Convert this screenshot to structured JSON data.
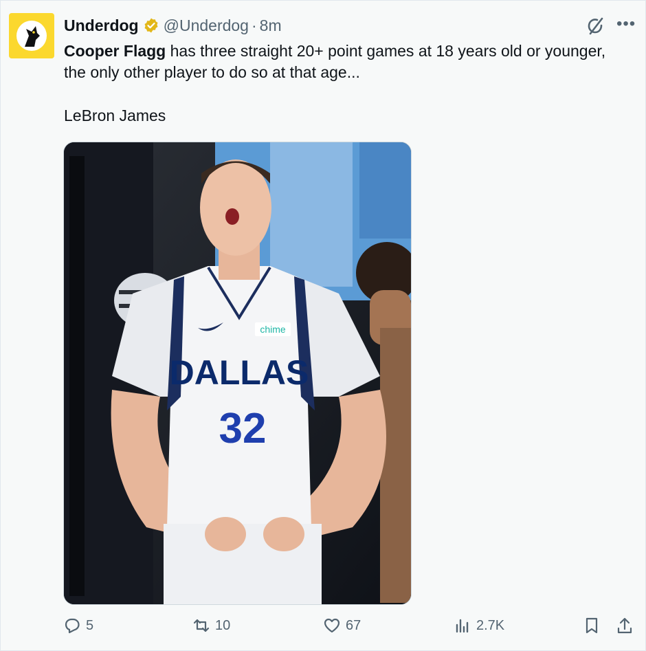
{
  "tweet": {
    "author_name": "Underdog",
    "handle": "@Underdog",
    "separator": "·",
    "time": "8m",
    "mention": "Cooper Flagg",
    "text_rest": " has three straight 20+ point games at 18 years old or younger, the only other player to do so at that age...",
    "text_line2": "LeBron James"
  },
  "image": {
    "jersey_team": "DALLAS",
    "jersey_number": "32",
    "sponsor": "chime"
  },
  "actions": {
    "replies": "5",
    "retweets": "10",
    "likes": "67",
    "views": "2.7K"
  },
  "icons": {
    "verified": "verified-badge-icon",
    "grok": "grok-icon",
    "more": "more-icon",
    "reply": "reply-icon",
    "retweet": "retweet-icon",
    "like": "heart-icon",
    "views": "views-icon",
    "bookmark": "bookmark-icon",
    "share": "share-icon"
  },
  "colors": {
    "background": "#f7f9f9",
    "text": "#0f1419",
    "secondary": "#536471",
    "verified": "#e2b719",
    "avatar_bg": "#fbd82e",
    "jersey_navy": "#0b2a6b"
  }
}
